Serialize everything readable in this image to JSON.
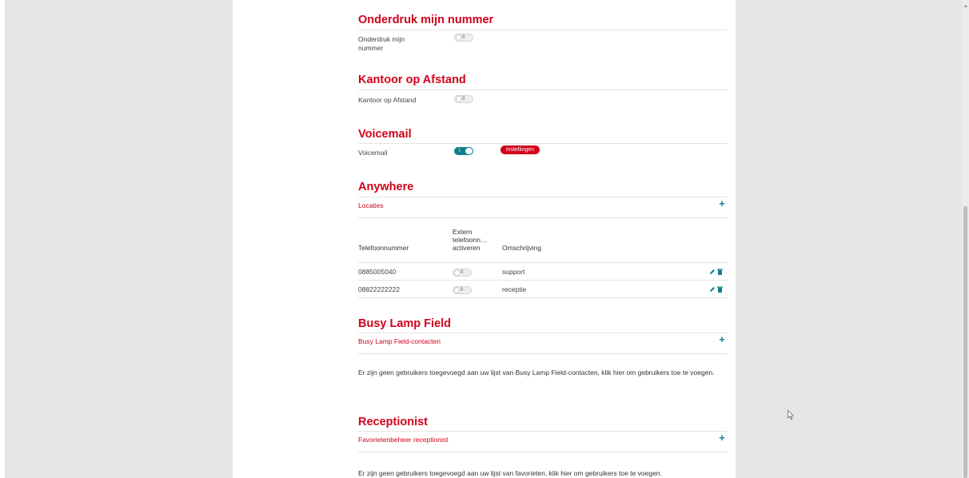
{
  "sections": {
    "onderdruk": {
      "title": "Onderdruk mijn nummer",
      "label": "Onderdruk mijn nummer",
      "toggle_text": "0"
    },
    "kantoor": {
      "title": "Kantoor op Afstand",
      "label": "Kantoor op Afstand",
      "toggle_text": "0"
    },
    "voicemail": {
      "title": "Voicemail",
      "label": "Voicemail",
      "toggle_text": "I",
      "settings_label": "instellingen"
    },
    "anywhere": {
      "title": "Anywhere",
      "link": "Locaties",
      "table": {
        "headers": [
          "Telefoonnummer",
          "Extern telefoonn… activeren",
          "Omschrijving"
        ],
        "rows": [
          {
            "number": "0885005040",
            "toggle_text": "0",
            "description": "support"
          },
          {
            "number": "08822222222",
            "toggle_text": "0",
            "description": "receptie"
          }
        ]
      }
    },
    "blf": {
      "title": "Busy Lamp Field",
      "link": "Busy Lamp Field-contacten",
      "message": "Er zijn geen gebruikers toegevoegd aan uw lijst van Busy Lamp Field-contacten, klik hier om gebruikers toe te voegen."
    },
    "receptionist": {
      "title": "Receptionist",
      "link": "Favorietenbeheer receptionist",
      "message": "Er zijn geen gebruikers toegevoegd aan uw lijst van favorieten, klik hier om gebruikers toe te voegen."
    }
  },
  "colors": {
    "accent": "#d0021b",
    "teal": "#0f7f8d"
  },
  "icons": [
    "plus-icon",
    "pencil-icon",
    "trash-icon",
    "cursor-icon"
  ]
}
